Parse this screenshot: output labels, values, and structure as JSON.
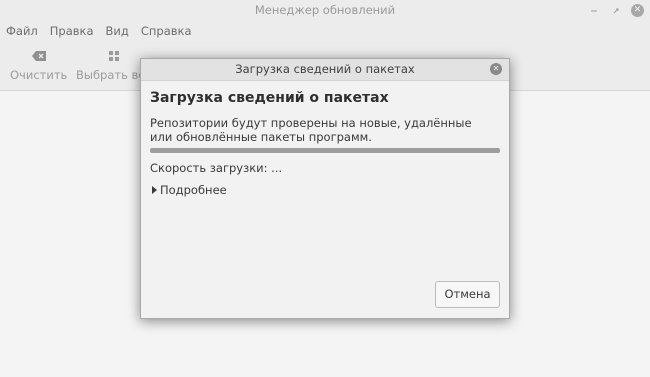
{
  "window": {
    "title": "Менеджер обновлений",
    "controls": [
      "minimize-icon",
      "maximize-icon",
      "close-icon"
    ]
  },
  "menubar": {
    "items": [
      "Файл",
      "Правка",
      "Вид",
      "Справка"
    ]
  },
  "toolbar": {
    "clear_label": "Очистить",
    "clear_icon": "backspace-icon",
    "select_all_label": "Выбрать все",
    "select_all_icon": "grid-icon"
  },
  "dialog": {
    "title": "Загрузка сведений о пакетах",
    "heading": "Загрузка сведений о пакетах",
    "description": "Репозитории будут проверены на новые, удалённые или обновлённые пакеты программ.",
    "progress_fraction": 1.0,
    "speed_text": "Скорость загрузки: ...",
    "details_label": "Подробнее",
    "cancel_label": "Отмена"
  },
  "colors": {
    "progress_fill": "#9e9e9e",
    "dialog_bg": "#f2f2f2",
    "window_bg": "#ececec"
  }
}
